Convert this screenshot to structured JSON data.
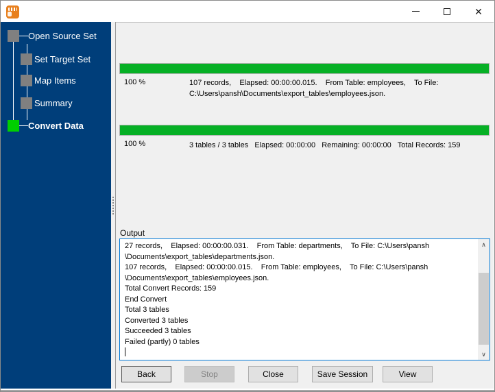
{
  "window": {
    "controls": {
      "minimize": "minimize",
      "maximize": "maximize",
      "close": "✕"
    }
  },
  "sidebar": {
    "steps": [
      {
        "label": "Open Source Set"
      },
      {
        "label": "Set Target Set"
      },
      {
        "label": "Map Items"
      },
      {
        "label": "Summary"
      },
      {
        "label": "Convert Data"
      }
    ],
    "active_step": "Convert Data"
  },
  "current_table_progress": {
    "percent": "100 %",
    "value": 100,
    "detail_lines": [
      "107 records,    Elapsed: 00:00:00.015.    From Table: employees,    To File:",
      "C:\\Users\\pansh\\Documents\\export_tables\\employees.json."
    ]
  },
  "overall_progress": {
    "percent": "100 %",
    "value": 100,
    "detail_lines": [
      "3 tables / 3 tables   Elapsed: 00:00:00   Remaining: 00:00:00   Total Records: 159"
    ]
  },
  "output": {
    "label": "Output",
    "lines": [
      "27 records,    Elapsed: 00:00:00.031.    From Table: departments,    To File: C:\\Users\\pansh",
      "\\Documents\\export_tables\\departments.json.",
      "107 records,    Elapsed: 00:00:00.015.    From Table: employees,    To File: C:\\Users\\pansh",
      "\\Documents\\export_tables\\employees.json.",
      "Total Convert Records: 159",
      "End Convert",
      "Total 3 tables",
      "Converted 3 tables",
      "Succeeded 3 tables",
      "Failed (partly) 0 tables"
    ]
  },
  "scrollbar": {
    "up": "∧",
    "down": "∨"
  },
  "buttons": [
    {
      "label": "Back",
      "enabled": true
    },
    {
      "label": "Stop",
      "enabled": false
    },
    {
      "label": "Close",
      "enabled": true
    },
    {
      "label": "Save Session",
      "enabled": true
    },
    {
      "label": "View",
      "enabled": true
    }
  ],
  "colors": {
    "sidebar_blue": "#003e7a",
    "progress_green": "#06b025",
    "step_active_green": "#00cf00",
    "step_done_gray": "#808080",
    "focus_border_blue": "#0078d7"
  }
}
